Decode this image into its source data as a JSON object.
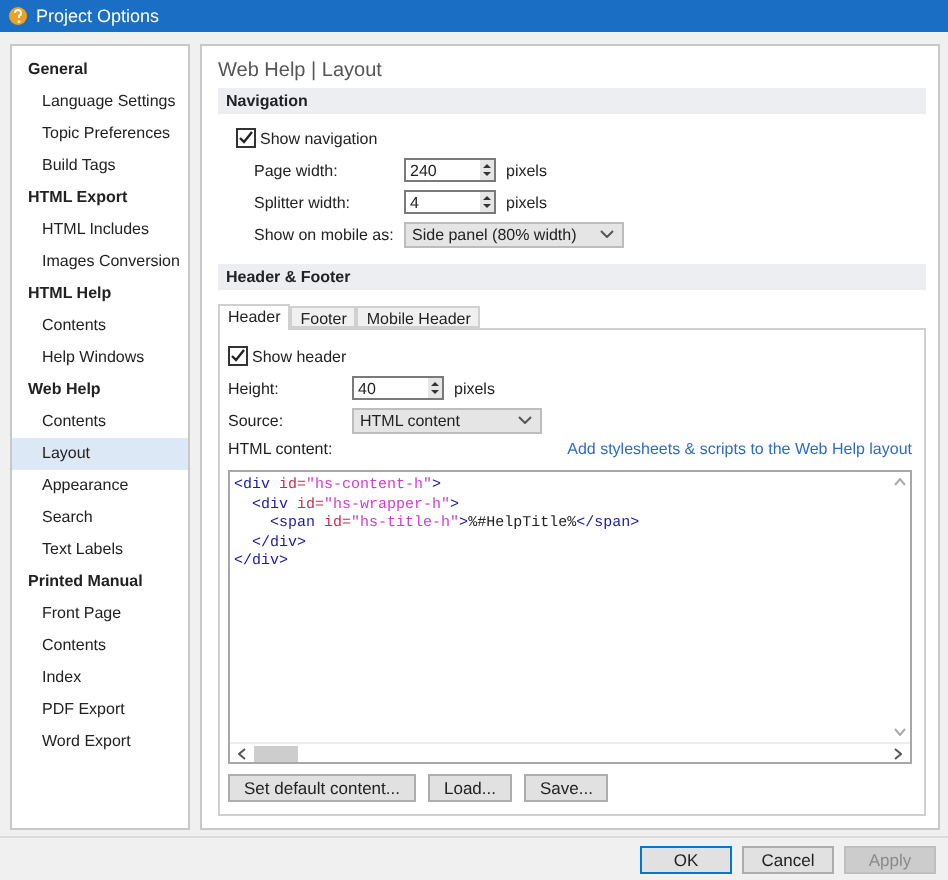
{
  "window": {
    "title": "Project Options"
  },
  "sidebar": {
    "groups": [
      {
        "label": "General",
        "items": [
          {
            "label": "Language Settings",
            "selected": false
          },
          {
            "label": "Topic Preferences",
            "selected": false
          },
          {
            "label": "Build Tags",
            "selected": false
          }
        ]
      },
      {
        "label": "HTML Export",
        "items": [
          {
            "label": "HTML Includes",
            "selected": false
          },
          {
            "label": "Images Conversion",
            "selected": false
          }
        ]
      },
      {
        "label": "HTML Help",
        "items": [
          {
            "label": "Contents",
            "selected": false
          },
          {
            "label": "Help Windows",
            "selected": false
          }
        ]
      },
      {
        "label": "Web Help",
        "items": [
          {
            "label": "Contents",
            "selected": false
          },
          {
            "label": "Layout",
            "selected": true
          },
          {
            "label": "Appearance",
            "selected": false
          },
          {
            "label": "Search",
            "selected": false
          },
          {
            "label": "Text Labels",
            "selected": false
          }
        ]
      },
      {
        "label": "Printed Manual",
        "items": [
          {
            "label": "Front Page",
            "selected": false
          },
          {
            "label": "Contents",
            "selected": false
          },
          {
            "label": "Index",
            "selected": false
          },
          {
            "label": "PDF Export",
            "selected": false
          },
          {
            "label": "Word Export",
            "selected": false
          }
        ]
      }
    ]
  },
  "page_title": "Web Help | Layout",
  "navigation": {
    "heading": "Navigation",
    "show": {
      "label": "Show navigation",
      "checked": true
    },
    "fields": [
      {
        "kind": "spin",
        "label": "Page width:",
        "value": "240",
        "unit": "pixels"
      },
      {
        "kind": "spin",
        "label": "Splitter width:",
        "value": "4",
        "unit": "pixels"
      },
      {
        "kind": "select",
        "label": "Show on mobile as:",
        "value": "Side panel (80% width)"
      }
    ]
  },
  "header_footer": {
    "heading": "Header & Footer",
    "tabs": [
      {
        "label": "Header",
        "selected": true
      },
      {
        "label": "Footer",
        "selected": false
      },
      {
        "label": "Mobile Header",
        "selected": false
      }
    ],
    "show": {
      "label": "Show header",
      "checked": true
    },
    "fields": [
      {
        "kind": "spin",
        "label": "Height:",
        "value": "40",
        "unit": "pixels"
      },
      {
        "kind": "select",
        "label": "Source:",
        "value": "HTML content"
      }
    ],
    "content_label": "HTML content:",
    "link": "Add stylesheets & scripts to the Web Help layout",
    "code": [
      [
        {
          "kind": "tag",
          "text": "<div "
        },
        {
          "kind": "attr",
          "text": "id="
        },
        {
          "kind": "value",
          "text": "\"hs-content-h\""
        },
        {
          "kind": "tag",
          "text": ">"
        }
      ],
      [
        {
          "kind": "tag",
          "text": "  <div "
        },
        {
          "kind": "attr",
          "text": "id="
        },
        {
          "kind": "value",
          "text": "\"hs-wrapper-h\""
        },
        {
          "kind": "tag",
          "text": ">"
        }
      ],
      [
        {
          "kind": "tag",
          "text": "    <span "
        },
        {
          "kind": "attr",
          "text": "id="
        },
        {
          "kind": "value",
          "text": "\"hs-title-h\""
        },
        {
          "kind": "tag",
          "text": ">"
        },
        {
          "kind": "text",
          "text": "%#HelpTitle%"
        },
        {
          "kind": "tag",
          "text": "</span>"
        }
      ],
      [
        {
          "kind": "tag",
          "text": "  </div>"
        }
      ],
      [
        {
          "kind": "tag",
          "text": "</div>"
        }
      ]
    ],
    "buttons": [
      "Set default content...",
      "Load...",
      "Save..."
    ]
  },
  "dialog_buttons": [
    {
      "label": "OK",
      "disabled": false
    },
    {
      "label": "Cancel",
      "disabled": false
    },
    {
      "label": "Apply",
      "disabled": true
    }
  ]
}
